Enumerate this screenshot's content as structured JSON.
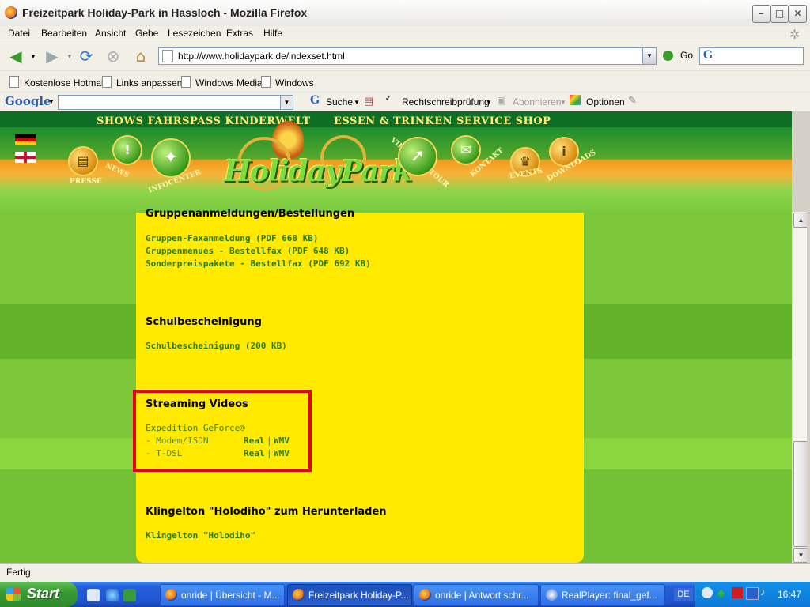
{
  "window": {
    "title": "Freizeitpark Holiday-Park in Hassloch - Mozilla Firefox"
  },
  "menu": [
    "Datei",
    "Bearbeiten",
    "Ansicht",
    "Gehe",
    "Lesezeichen",
    "Extras",
    "Hilfe"
  ],
  "nav": {
    "url": "http://www.holidaypark.de/indexset.html",
    "go": "Go"
  },
  "bookmarks": [
    "Kostenlose Hotmail",
    "Links anpassen",
    "Windows Media",
    "Windows"
  ],
  "google": {
    "logo": "Google",
    "search": "Suche",
    "spell": "Rechtschreibprüfung",
    "subscribe": "Abonnieren",
    "options": "Optionen"
  },
  "site": {
    "nav_left": "SHOWS  FAHRSPASS  KINDERWELT",
    "nav_right": "ESSEN & TRINKEN  SERVICE  SHOP",
    "logo": "HolidayPark",
    "buttons": {
      "presse": "PRESSE",
      "news": "NEWS",
      "infocenter": "INFOCENTER",
      "tour": "VIRTUELLE TOUR",
      "kontakt": "KONTAKT",
      "events": "EVENTS",
      "downloads": "DOWNLOADS"
    }
  },
  "content": {
    "group_heading": "Gruppenanmeldungen/Bestellungen",
    "group_links": [
      "Gruppen-Faxanmeldung (PDF 668 KB)",
      "Gruppenmenues - Bestellfax (PDF 648 KB)",
      "Sonderpreispakete - Bestellfax (PDF 692 KB)"
    ],
    "school_heading": "Schulbescheinigung",
    "school_link": "Schulbescheinigung (200 KB)",
    "stream_heading": "Streaming Videos",
    "stream_title": "Expedition GeForce®",
    "stream_rows": [
      {
        "label": "- Modem/ISDN",
        "real": "Real",
        "sep": "|",
        "wmv": "WMV"
      },
      {
        "label": "- T-DSL",
        "real": "Real",
        "sep": "|",
        "wmv": "WMV"
      }
    ],
    "ring_heading": "Klingelton \"Holodiho\" zum Herunterladen",
    "ring_link": "Klingelton \"Holodiho\""
  },
  "status": "Fertig",
  "taskbar": {
    "start": "Start",
    "tasks": [
      "onride | Übersicht - M...",
      "Freizeitpark Holiday-P...",
      "onride | Antwort schr...",
      "RealPlayer: final_gef..."
    ],
    "lang": "DE",
    "clock": "16:47"
  }
}
